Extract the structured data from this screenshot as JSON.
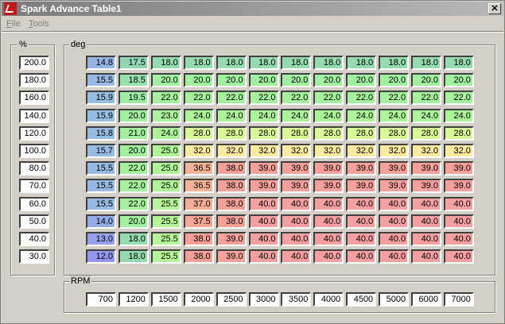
{
  "window": {
    "title": "Spark Advance Table1",
    "close_label": "✕"
  },
  "menu": [
    {
      "label": "File",
      "accel": "F"
    },
    {
      "label": "Tools",
      "accel": "T"
    }
  ],
  "load_axis": {
    "label": "%",
    "values": [
      "200.0",
      "180.0",
      "160.0",
      "140.0",
      "120.0",
      "100.0",
      "80.0",
      "70.0",
      "60.0",
      "50.0",
      "40.0",
      "30.0"
    ]
  },
  "table": {
    "label": "deg",
    "rows": [
      [
        "14.8",
        "17.5",
        "18.0",
        "18.0",
        "18.0",
        "18.0",
        "18.0",
        "18.0",
        "18.0",
        "18.0",
        "18.0",
        "18.0"
      ],
      [
        "15.5",
        "18.5",
        "20.0",
        "20.0",
        "20.0",
        "20.0",
        "20.0",
        "20.0",
        "20.0",
        "20.0",
        "20.0",
        "20.0"
      ],
      [
        "15.9",
        "19.5",
        "22.0",
        "22.0",
        "22.0",
        "22.0",
        "22.0",
        "22.0",
        "22.0",
        "22.0",
        "22.0",
        "22.0"
      ],
      [
        "15.9",
        "20.0",
        "23.0",
        "24.0",
        "24.0",
        "24.0",
        "24.0",
        "24.0",
        "24.0",
        "24.0",
        "24.0",
        "24.0"
      ],
      [
        "15.8",
        "21.0",
        "24.0",
        "28.0",
        "28.0",
        "28.0",
        "28.0",
        "28.0",
        "28.0",
        "28.0",
        "28.0",
        "28.0"
      ],
      [
        "15.7",
        "20.0",
        "25.0",
        "32.0",
        "32.0",
        "32.0",
        "32.0",
        "32.0",
        "32.0",
        "32.0",
        "32.0",
        "32.0"
      ],
      [
        "15.5",
        "22.0",
        "25.0",
        "36.5",
        "38.0",
        "39.0",
        "39.0",
        "39.0",
        "39.0",
        "39.0",
        "39.0",
        "39.0"
      ],
      [
        "15.5",
        "22.0",
        "25.0",
        "36.5",
        "38.0",
        "39.0",
        "39.0",
        "39.0",
        "39.0",
        "39.0",
        "39.0",
        "39.0"
      ],
      [
        "15.5",
        "22.0",
        "25.5",
        "37.0",
        "38.0",
        "40.0",
        "40.0",
        "40.0",
        "40.0",
        "40.0",
        "40.0",
        "40.0"
      ],
      [
        "14.0",
        "20.0",
        "25.5",
        "37.5",
        "38.0",
        "40.0",
        "40.0",
        "40.0",
        "40.0",
        "40.0",
        "40.0",
        "40.0"
      ],
      [
        "13.0",
        "18.0",
        "25.5",
        "38.0",
        "39.0",
        "40.0",
        "40.0",
        "40.0",
        "40.0",
        "40.0",
        "40.0",
        "40.0"
      ],
      [
        "12.0",
        "18.0",
        "25.5",
        "38.0",
        "39.0",
        "40.0",
        "40.0",
        "40.0",
        "40.0",
        "40.0",
        "40.0",
        "40.0"
      ]
    ]
  },
  "rpm_axis": {
    "label": "RPM",
    "values": [
      "700",
      "1200",
      "1500",
      "2000",
      "2500",
      "3000",
      "3500",
      "4000",
      "4500",
      "5000",
      "6000",
      "7000"
    ]
  },
  "colors": {
    "title_bar_start": "#7b7b7b",
    "title_bar_end": "#b8b8b8",
    "window_bg": "#d4d0c8"
  }
}
